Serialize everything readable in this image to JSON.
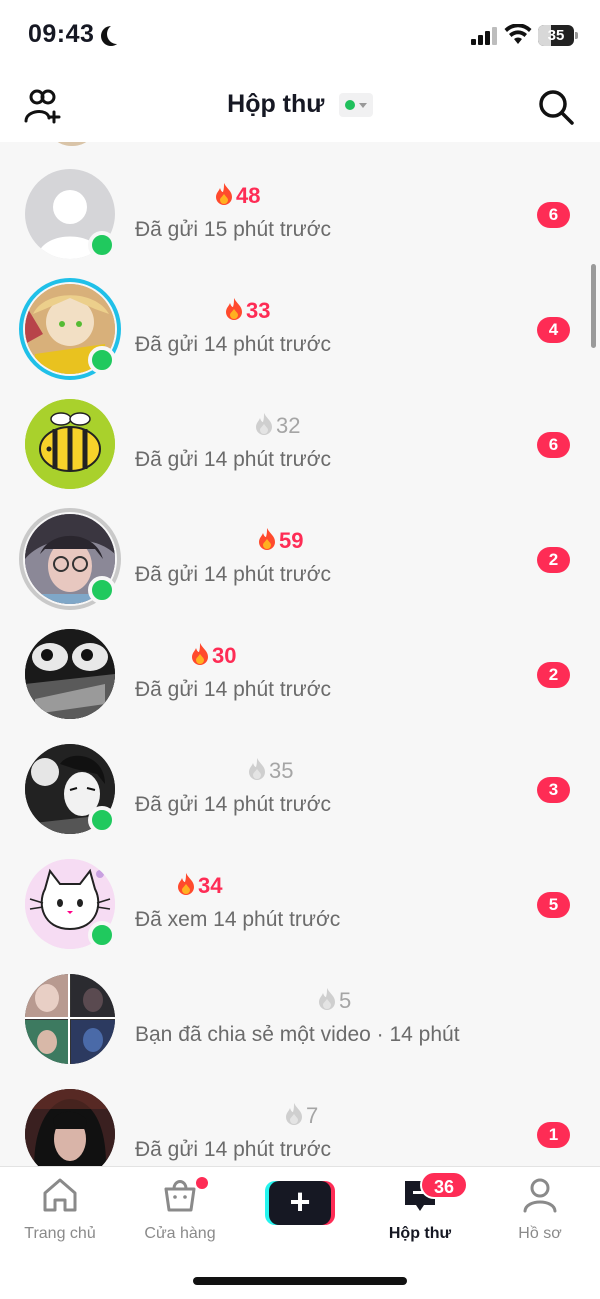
{
  "status_bar": {
    "time": "09:43",
    "battery": "35",
    "battery_level": 0.35
  },
  "header": {
    "title": "Hộp thư"
  },
  "icons": {
    "add_friend": "add-friend-icon",
    "search": "search-icon",
    "flame": "flame-icon"
  },
  "colors": {
    "accent": "#fe2c55",
    "online": "#20c95e",
    "story_ring": "#20c0e8",
    "muted": "#a5a5a5"
  },
  "conversations": [
    {
      "streak": "48",
      "streak_active": true,
      "meta": "Đã gửi 15 phút trước",
      "badge": "6",
      "online": true
    },
    {
      "streak": "33",
      "streak_active": true,
      "meta": "Đã gửi 14 phút trước",
      "badge": "4",
      "online": true
    },
    {
      "streak": "32",
      "streak_active": false,
      "meta": "Đã gửi 14 phút trước",
      "badge": "6",
      "online": false
    },
    {
      "streak": "59",
      "streak_active": true,
      "meta": "Đã gửi 14 phút trước",
      "badge": "2",
      "online": true
    },
    {
      "streak": "30",
      "streak_active": true,
      "meta": "Đã gửi 14 phút trước",
      "badge": "2",
      "online": false
    },
    {
      "streak": "35",
      "streak_active": false,
      "meta": "Đã gửi 14 phút trước",
      "badge": "3",
      "online": true
    },
    {
      "streak": "34",
      "streak_active": true,
      "meta": "Đã xem 14 phút trước",
      "badge": "5",
      "online": true
    },
    {
      "streak": "5",
      "streak_active": false,
      "meta": "Bạn đã chia sẻ một video · 14 phút",
      "badge": "",
      "online": false
    },
    {
      "streak": "7",
      "streak_active": false,
      "meta": "Đã gửi 14 phút trước",
      "badge": "1",
      "online": false
    }
  ],
  "bottom_nav": {
    "home": "Trang chủ",
    "shop": "Cửa hàng",
    "create": "+",
    "inbox": "Hộp thư",
    "inbox_badge": "36",
    "profile": "Hồ sơ"
  }
}
